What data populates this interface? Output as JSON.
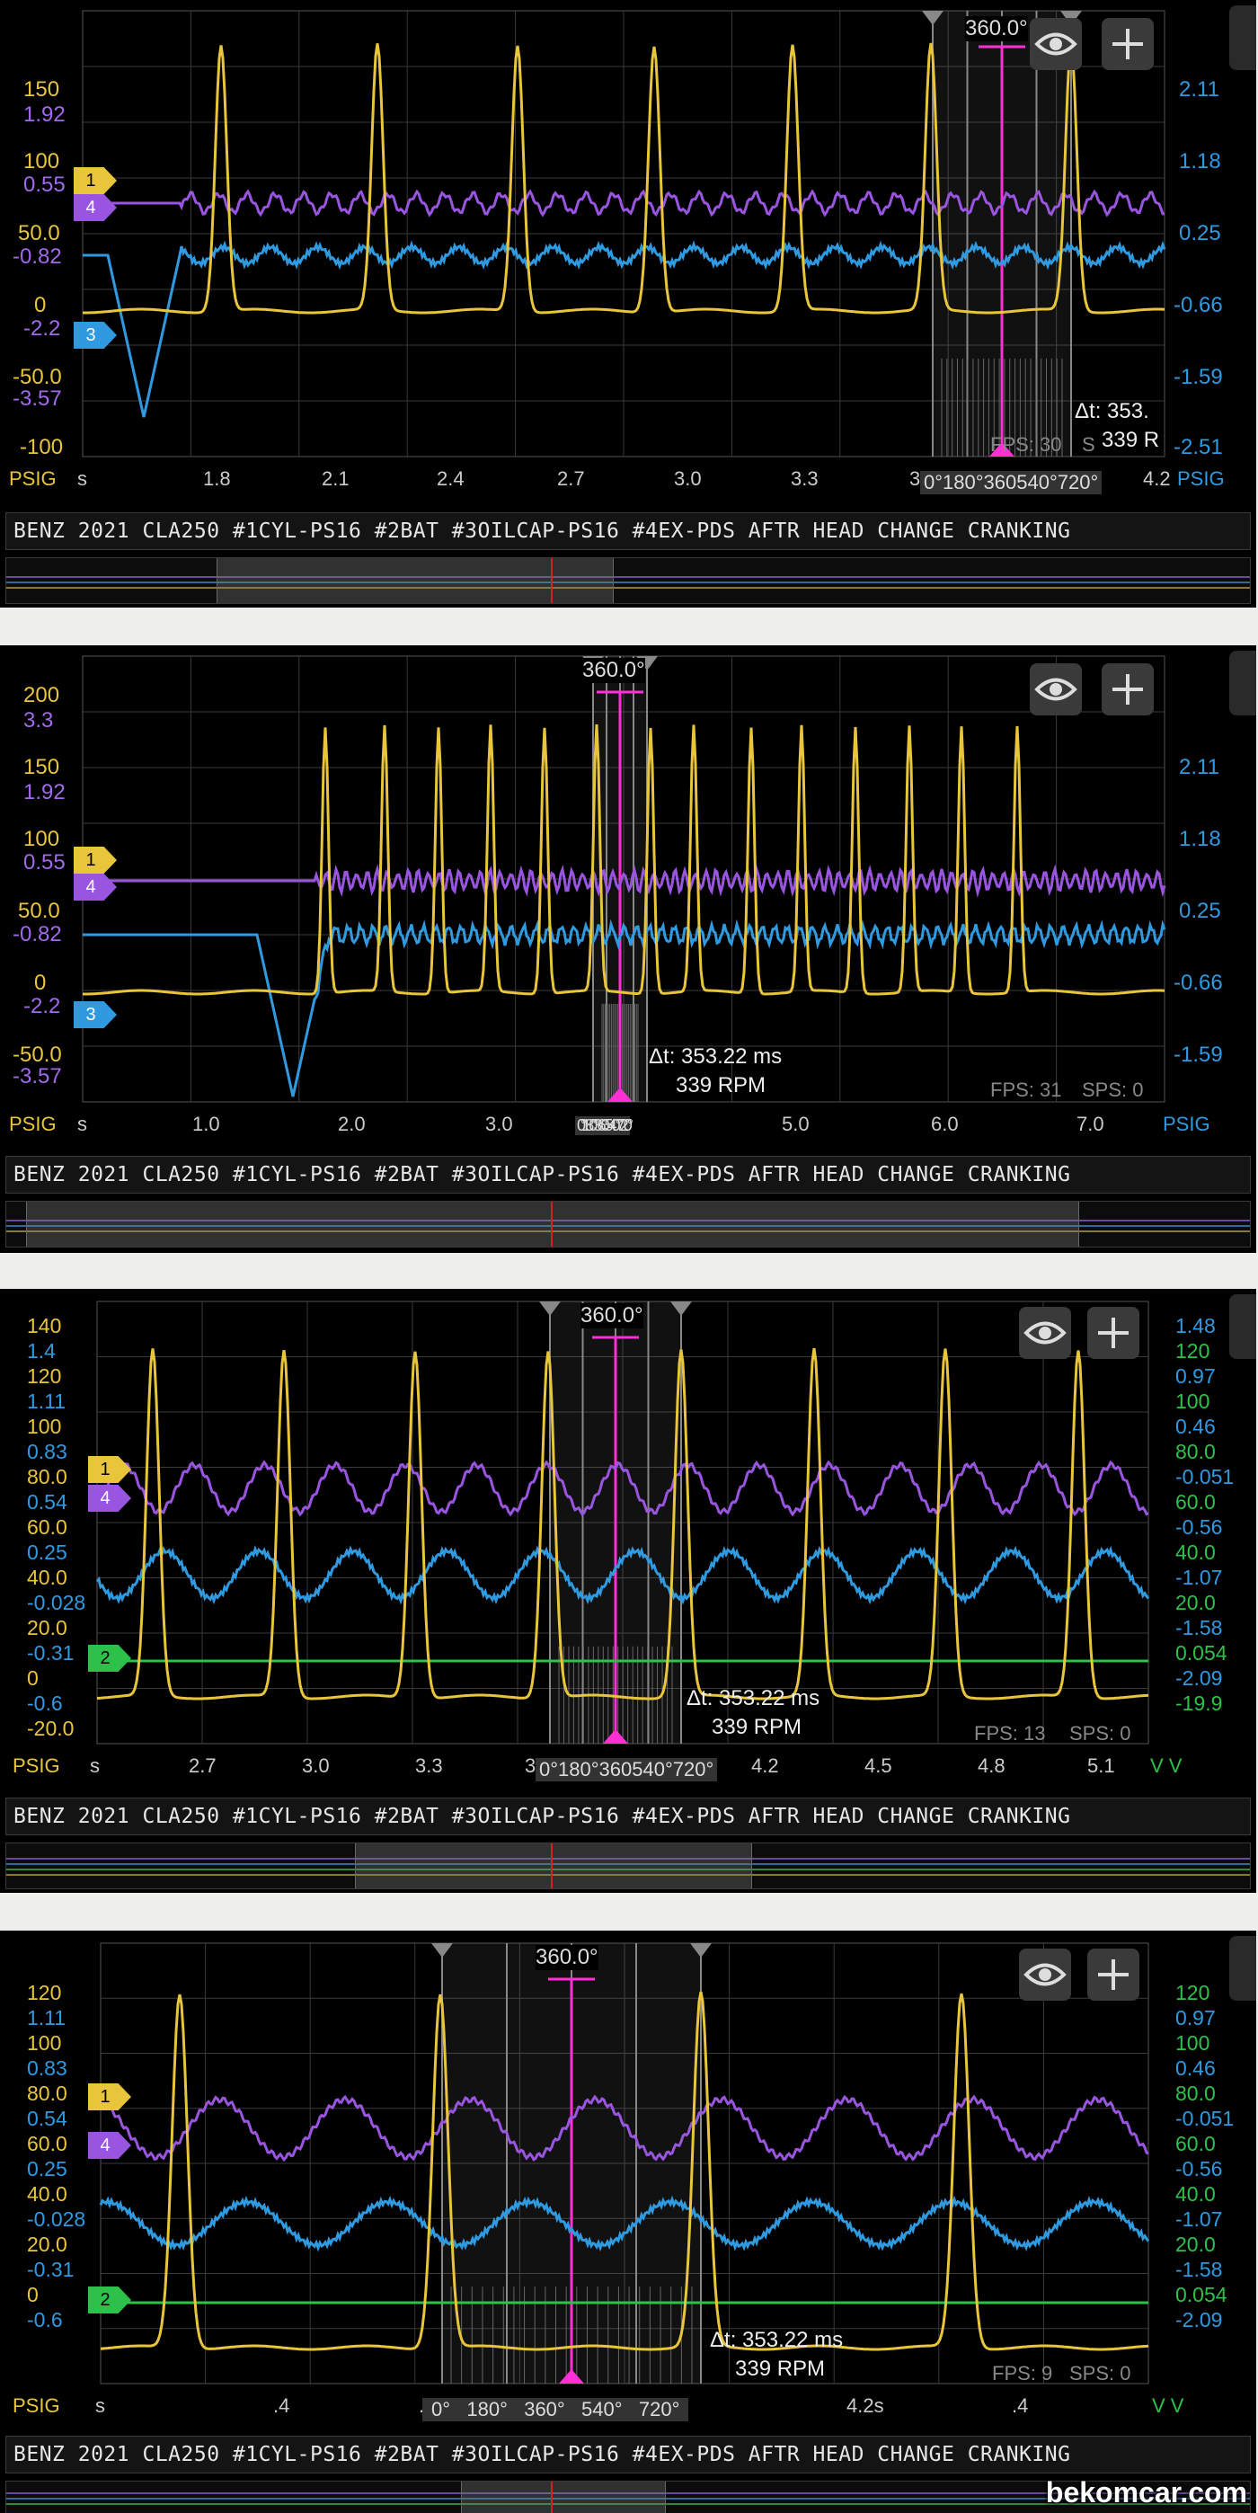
{
  "app_title": "BENZ 2021 CLA250 #1CYL-PS16 #2BAT #3OILCAP-PS16 #4EX-PDS AFTR HEAD CHANGE CRANKING",
  "watermark": "bekomcar.com",
  "colors": {
    "ch1": "#e8c53a",
    "ch2": "#2ec14a",
    "ch3": "#2f9ae0",
    "ch4": "#9a55e0",
    "cursor": "#ff2fd6",
    "grid": "#3a3a3a"
  },
  "icons": [
    "eye-icon",
    "plus-icon",
    "side-tab-handle"
  ],
  "panels": [
    {
      "angle_label": "360.0°",
      "angle_marks": "0°180°360540°720°",
      "delta_t": "Δt: 353.",
      "rpm": "339 R",
      "fps": "FPS: 30",
      "sps": "S",
      "x_unit": "s",
      "left_unit": "PSIG",
      "right_unit": "PSIG",
      "x_ticks": [
        "1.8",
        "2.1",
        "2.4",
        "2.7",
        "3.0",
        "3.3",
        "3.6",
        "4.2"
      ],
      "left_scale_a": [
        "150",
        "100",
        "50.0",
        "0",
        "-50.0",
        "-100"
      ],
      "left_scale_b": [
        "1.92",
        "0.55",
        "-0.82",
        "-2.2",
        "-3.57"
      ],
      "right_scale": [
        "2.11",
        "1.18",
        "0.25",
        "-0.66",
        "-1.59",
        "-2.51"
      ],
      "markers": [
        "1",
        "4",
        "3"
      ]
    },
    {
      "angle_label": "360.0°",
      "angle_marks": "0°180°360540°720°",
      "delta_t": "Δt: 353.22 ms",
      "rpm": "339 RPM",
      "fps": "FPS: 31",
      "sps": "SPS: 0",
      "x_unit": "s",
      "left_unit": "PSIG",
      "right_unit": "PSIG",
      "x_ticks": [
        "1.0",
        "2.0",
        "3.0",
        "5.0",
        "6.0",
        "7.0"
      ],
      "left_scale_a": [
        "200",
        "150",
        "100",
        "50.0",
        "0",
        "-50.0"
      ],
      "left_scale_b": [
        "3.3",
        "1.92",
        "0.55",
        "-0.82",
        "-2.2",
        "-3.57"
      ],
      "right_scale": [
        "2.11",
        "1.18",
        "0.25",
        "-0.66",
        "-1.59"
      ],
      "markers": [
        "1",
        "4",
        "3"
      ]
    },
    {
      "angle_label": "360.0°",
      "angle_marks": "0°180°360540°720°",
      "delta_t": "Δt: 353.22 ms",
      "rpm": "339 RPM",
      "fps": "FPS: 13",
      "sps": "SPS: 0",
      "x_unit": "s",
      "left_unit": "PSIG",
      "right_unit": "V  V",
      "x_ticks": [
        "2.7",
        "3.0",
        "3.3",
        "3.6",
        "4.2",
        "4.5",
        "4.8",
        "5.1"
      ],
      "left_scale_a": [
        "140",
        "120",
        "100",
        "80.0",
        "60.0",
        "40.0",
        "20.0",
        "0",
        "-20.0"
      ],
      "left_scale_b": [
        "1.4",
        "1.11",
        "0.83",
        "0.54",
        "0.25",
        "-0.028",
        "-0.31",
        "-0.6"
      ],
      "right_scale_a": [
        "1.48",
        "0.97",
        "0.46",
        "-0.051",
        "-0.56",
        "-1.07",
        "-1.58",
        "-2.09"
      ],
      "right_scale_b": [
        "120",
        "100",
        "80.0",
        "60.0",
        "40.0",
        "20.0",
        "0.054",
        "-19.9"
      ],
      "markers": [
        "1",
        "4",
        "2"
      ]
    },
    {
      "angle_label": "360.0°",
      "angle_marks": "0°   180°   360°   540°   720°",
      "delta_t": "Δt: 353.22 ms",
      "rpm": "339 RPM",
      "fps": "FPS: 9",
      "sps": "SPS: 0",
      "x_unit": "s",
      "left_unit": "PSIG",
      "right_unit": "V  V",
      "x_ticks": [
        ".4",
        ".6",
        "4.2s",
        ".4"
      ],
      "left_scale_a": [
        "120",
        "100",
        "80.0",
        "60.0",
        "40.0",
        "20.0",
        "0"
      ],
      "left_scale_b": [
        "1.11",
        "0.83",
        "0.54",
        "0.25",
        "-0.028",
        "-0.31",
        "-0.6"
      ],
      "right_scale_a": [
        "0.97",
        "0.46",
        "-0.051",
        "-0.56",
        "-1.07",
        "-1.58",
        "-2.09"
      ],
      "right_scale_b": [
        "120",
        "100",
        "80.0",
        "60.0",
        "40.0",
        "20.0",
        "0.054"
      ],
      "markers": [
        "1",
        "4",
        "2"
      ]
    }
  ]
}
